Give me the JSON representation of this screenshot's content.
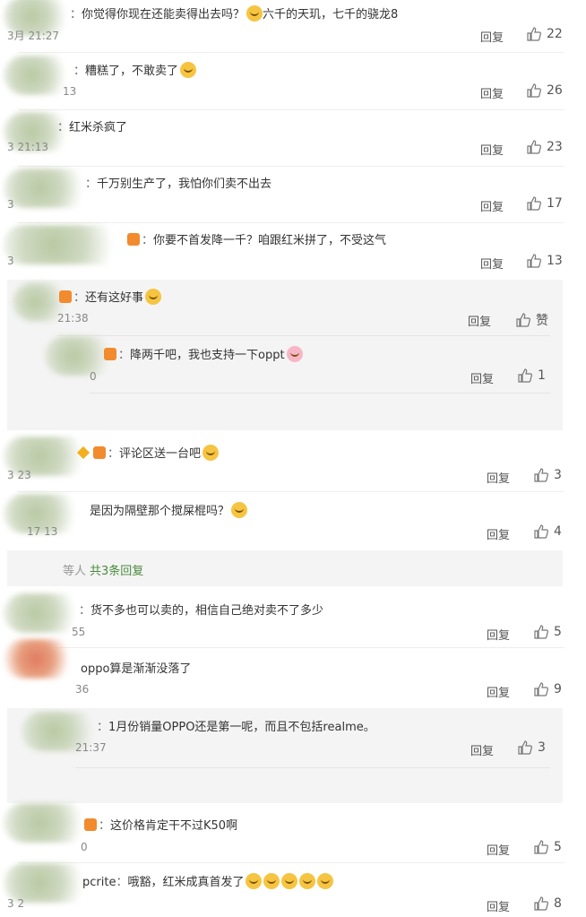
{
  "comments": [
    {
      "text": "你觉得你现在还能卖得出去吗？",
      "tail": "六千的天玑，七千的骁龙8",
      "time": "3月 21:27",
      "reply": "回复",
      "likes": "22"
    },
    {
      "text": "糟糕了，不敢卖了",
      "time": "13",
      "reply": "回复",
      "likes": "26"
    },
    {
      "text": "红米杀疯了",
      "time": "3 21:13",
      "reply": "回复",
      "likes": "23"
    },
    {
      "text": "千万别生产了，我怕你们卖不出去",
      "time": "3",
      "reply": "回复",
      "likes": "17"
    },
    {
      "text": "你要不首发降一千？咱跟红米拼了，不受这气",
      "time": "3",
      "reply": "回复",
      "likes": "13"
    }
  ],
  "sub_thread_1": [
    {
      "text": "还有这好事",
      "time": "21:38",
      "reply": "回复",
      "likes": "赞"
    },
    {
      "text": "降两千吧，我也支持一下oppt",
      "time": "0",
      "reply": "回复",
      "likes": "1"
    }
  ],
  "comments2": [
    {
      "text": "评论区送一台吧",
      "time": "3 23",
      "reply": "回复",
      "likes": "3"
    },
    {
      "text": "是因为隔壁那个搅屎棍吗？",
      "time": "17 13",
      "reply": "回复",
      "likes": "4"
    }
  ],
  "more_replies": {
    "prefix": "等人",
    "label": "共3条回复"
  },
  "comments3": [
    {
      "text": "货不多也可以卖的，相信自己绝对卖不了多少",
      "time": "55",
      "reply": "回复",
      "likes": "5"
    },
    {
      "text": "oppo算是渐渐没落了",
      "time": "36",
      "reply": "回复",
      "likes": "9"
    }
  ],
  "sub_thread_2": [
    {
      "text": "1月份销量OPPO还是第一呢，而且不包括realme。",
      "time": "21:37",
      "reply": "回复",
      "likes": "3"
    }
  ],
  "comments4": [
    {
      "text": "这价格肯定干不过K50啊",
      "time": "0",
      "reply": "回复",
      "likes": "5"
    },
    {
      "text": "哦豁，红米成真首发了",
      "name_tail": "pcrite",
      "time": "3 2",
      "reply": "回复",
      "likes": "8"
    }
  ],
  "icons": {
    "like": "thumbs-up-icon",
    "emoji": "emoji-face-icon"
  },
  "colors": {
    "link_green": "#4a8a3c",
    "panel": "#f4f4f4",
    "divider": "#eeeeee"
  }
}
